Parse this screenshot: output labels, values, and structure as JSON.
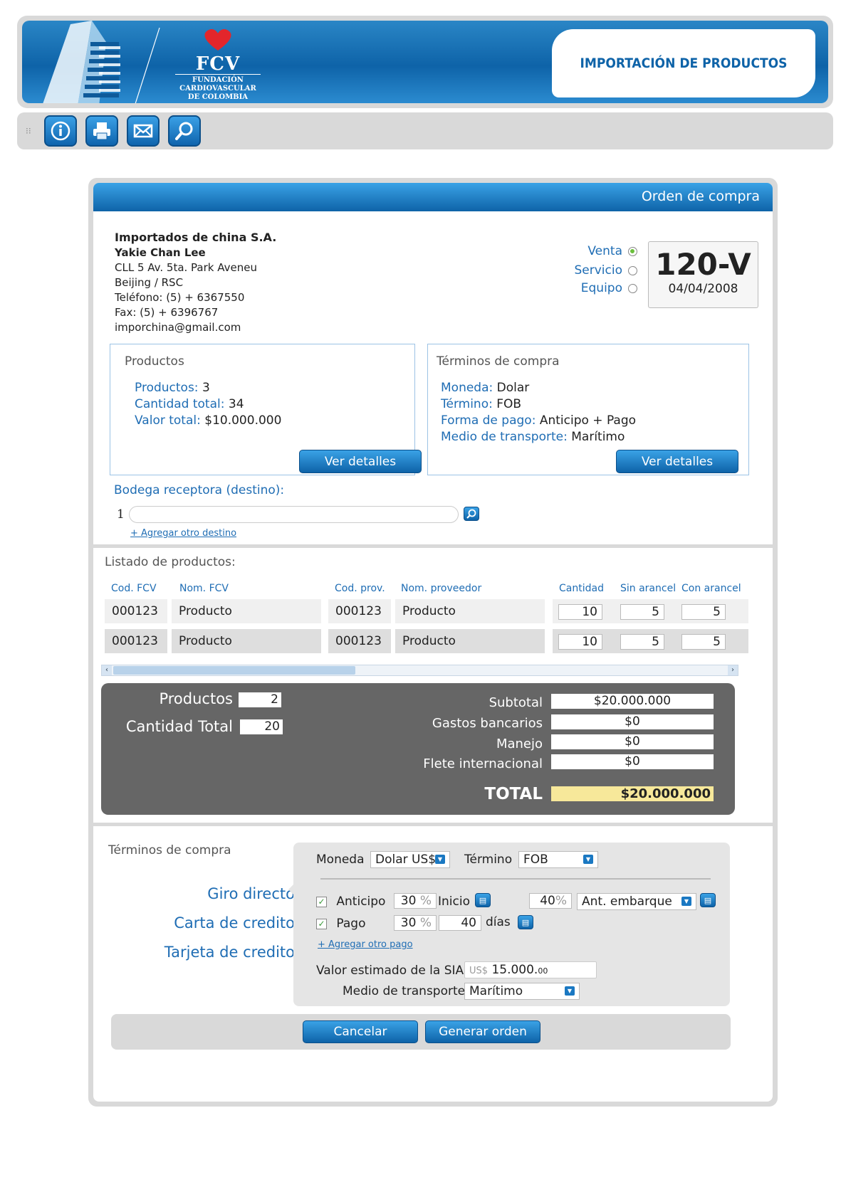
{
  "header": {
    "logo_text": "FCV",
    "logo_sub": [
      "FUNDACIÓN",
      "CARDIOVASCULAR",
      "DE COLOMBIA"
    ],
    "title": "IMPORTACIÓN DE PRODUCTOS"
  },
  "toolbar": {
    "icons": [
      "info-icon",
      "print-icon",
      "mail-icon",
      "search-icon"
    ]
  },
  "order": {
    "panel_title": "Orden de compra",
    "supplier": {
      "name": "Importados de china S.A.",
      "contact": "Yakie Chan Lee",
      "address": "CLL 5 Av. 5ta. Park Aveneu",
      "city": "Beijing / RSC",
      "phone": "Teléfono: (5) + 6367550",
      "fax": "Fax: (5) + 6396767",
      "email": "imporchina@gmail.com"
    },
    "type_options": [
      {
        "label": "Venta",
        "selected": true
      },
      {
        "label": "Servicio",
        "selected": false
      },
      {
        "label": "Equipo",
        "selected": false
      }
    ],
    "number": "120-V",
    "date": "04/04/2008"
  },
  "products_box": {
    "title": "Productos",
    "k1": "Productos:",
    "v1": " 3",
    "k2": "Cantidad total:",
    "v2": " 34",
    "k3": "Valor total:",
    "v3": " $10.000.000",
    "button": "Ver detalles"
  },
  "terms_box": {
    "title": "Términos de compra",
    "k1": "Moneda:",
    "v1": " Dolar",
    "k2": "Término:",
    "v2": " FOB",
    "k3": "Forma de pago:",
    "v3": " Anticipo + Pago",
    "k4": "Medio de transporte:",
    "v4": " Marítimo",
    "button": "Ver detalles"
  },
  "destination": {
    "label": "Bodega receptora (destino):",
    "index": "1",
    "value": "",
    "add_link": "+ Agregar otro destino"
  },
  "product_list": {
    "title": "Listado de productos:",
    "headers": [
      "Cod. FCV",
      "Nom. FCV",
      "Cod. prov.",
      "Nom. proveedor",
      "Cantidad",
      "Sin arancel",
      "Con arancel"
    ],
    "rows": [
      [
        "000123",
        "Producto",
        "000123",
        "Producto",
        "10",
        "5",
        "5"
      ],
      [
        "000123",
        "Producto",
        "000123",
        "Producto",
        "10",
        "5",
        "5"
      ]
    ]
  },
  "summary": {
    "productos_label": "Productos",
    "productos_value": "2",
    "cantidad_label": "Cantidad Total",
    "cantidad_value": "20",
    "subtotal_label": "Subtotal",
    "subtotal_value": "$20.000.000",
    "gastos_label": "Gastos bancarios",
    "gastos_value": "$0",
    "manejo_label": "Manejo",
    "manejo_value": "$0",
    "flete_label": "Flete internacional",
    "flete_value": "$0",
    "total_label": "TOTAL",
    "total_value": "$20.000.000",
    "total_bg": "#f7e89a"
  },
  "payment": {
    "title": "Términos de compra",
    "methods": [
      {
        "label": "Giro directo",
        "selected": true
      },
      {
        "label": "Carta de credito",
        "selected": false
      },
      {
        "label": "Tarjeta de credito",
        "selected": false
      }
    ],
    "moneda_label": "Moneda",
    "moneda_value": "Dolar US$",
    "termino_label": "Término",
    "termino_value": "FOB",
    "anticipo_label": "Anticipo",
    "anticipo_pct": "30",
    "pct": "%",
    "inicio_label": "Inicio",
    "anticipo_pct2": "40",
    "anticipo_event": "Ant. embarque",
    "pago_label": "Pago",
    "pago_pct": "30",
    "pago_days": "40",
    "dias_label": "días",
    "add_pago": "+ Agregar otro pago",
    "sia_label": "Valor estimado de la SIA",
    "sia_currency": "US$",
    "sia_value": "15.000.",
    "sia_cents": "00",
    "transport_label": "Medio de transporte",
    "transport_value": "Marítimo"
  },
  "actions": {
    "cancel": "Cancelar",
    "generate": "Generar orden"
  }
}
